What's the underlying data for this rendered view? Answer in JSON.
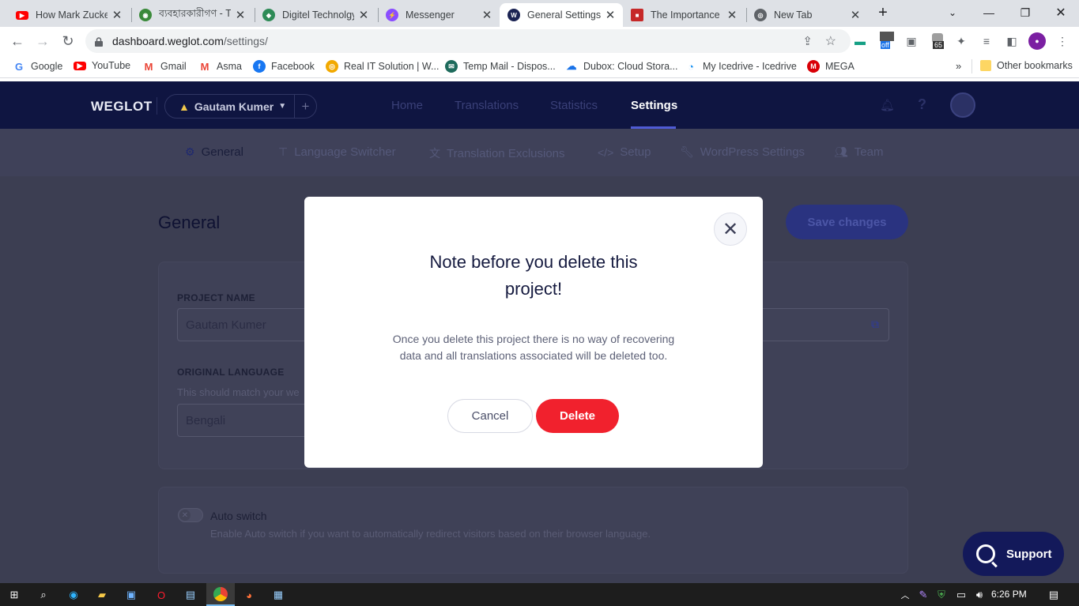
{
  "browser": {
    "tabs": [
      {
        "title": "How Mark Zucke",
        "icon": "youtube-icon",
        "color": "#ff0000"
      },
      {
        "title": "ব্যবহারকারীগণ - T",
        "icon": "site-icon",
        "color": "#3a8a3a"
      },
      {
        "title": "Digitel Technolgy",
        "icon": "site-icon",
        "color": "#2e8b57"
      },
      {
        "title": "Messenger",
        "icon": "messenger-icon",
        "color": "#8a4dff"
      },
      {
        "title": "General Settings",
        "icon": "weglot-icon",
        "color": "#1b2353",
        "active": true
      },
      {
        "title": "The Importance o",
        "icon": "site-icon",
        "color": "#c62828"
      },
      {
        "title": "New Tab",
        "icon": "chrome-icon",
        "color": "#5f6368"
      }
    ],
    "url_host": "dashboard.weglot.com",
    "url_path": "/settings/",
    "bookmarks": [
      {
        "label": "Google",
        "icon": "google-icon",
        "color": "#4285f4"
      },
      {
        "label": "YouTube",
        "icon": "youtube-icon",
        "color": "#ff0000"
      },
      {
        "label": "Gmail",
        "icon": "gmail-icon",
        "color": "#ea4335"
      },
      {
        "label": "Asma",
        "icon": "gmail-icon",
        "color": "#ea4335"
      },
      {
        "label": "Facebook",
        "icon": "facebook-icon",
        "color": "#1877f2"
      },
      {
        "label": "Real IT Solution | W...",
        "icon": "site-icon",
        "color": "#f2a900"
      },
      {
        "label": "Temp Mail - Dispos...",
        "icon": "site-icon",
        "color": "#1e6b5c"
      },
      {
        "label": "Dubox: Cloud Stora...",
        "icon": "cloud-icon",
        "color": "#1a73e8"
      },
      {
        "label": "My Icedrive - Icedrive",
        "icon": "icedrive-icon",
        "color": "#2196f3"
      },
      {
        "label": "MEGA",
        "icon": "mega-icon",
        "color": "#d90007"
      }
    ],
    "other_bookmarks": "Other bookmarks",
    "ext_badge_off": "off",
    "ext_badge_count": "65"
  },
  "app": {
    "logo": "WEGLOT",
    "project": "Gautam Kumer",
    "nav": [
      "Home",
      "Translations",
      "Statistics",
      "Settings"
    ],
    "subnav": [
      "General",
      "Language Switcher",
      "Translation Exclusions",
      "Setup",
      "WordPress Settings",
      "Team"
    ],
    "page_title": "General",
    "save_label": "Save changes",
    "project_name_label": "PROJECT NAME",
    "project_name_value": "Gautam Kumer",
    "original_language_label": "ORIGINAL LANGUAGE",
    "original_language_help": "This should match your we",
    "original_language_value": "Bengali",
    "auto_switch_label": "Auto switch",
    "auto_switch_help": "Enable Auto switch if you want to automatically redirect visitors based on their browser language.",
    "support_label": "Support"
  },
  "modal": {
    "title": "Note before you delete this project!",
    "text": "Once you delete this project there is no way of recovering data and all translations associated will be deleted too.",
    "cancel": "Cancel",
    "delete": "Delete"
  },
  "taskbar": {
    "time": "6:26 PM"
  }
}
